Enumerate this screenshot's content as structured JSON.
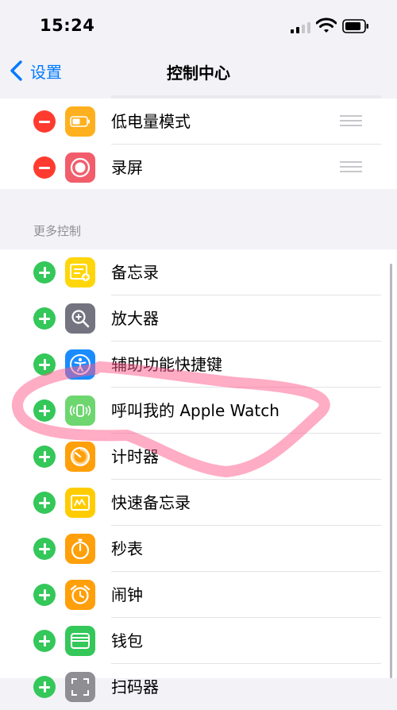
{
  "status_bar": {
    "time": "15:24"
  },
  "nav": {
    "back_label": "设置",
    "title": "控制中心"
  },
  "included": {
    "items": [
      {
        "label": "低电量模式",
        "icon": "battery-icon",
        "color": "#ffb01f"
      },
      {
        "label": "录屏",
        "icon": "record-icon",
        "color": "#f25d6b"
      }
    ]
  },
  "more": {
    "header": "更多控制",
    "items": [
      {
        "label": "备忘录",
        "icon": "notes-icon",
        "color": "#ffd60a"
      },
      {
        "label": "放大器",
        "icon": "magnifier-icon",
        "color": "#737480"
      },
      {
        "label": "辅助功能快捷键",
        "icon": "accessibility-icon",
        "color": "#1a8cff"
      },
      {
        "label": "呼叫我的 Apple Watch",
        "icon": "watch-ping-icon",
        "color": "#6ed66f"
      },
      {
        "label": "计时器",
        "icon": "timer-icon",
        "color": "#ff9f0a"
      },
      {
        "label": "快速备忘录",
        "icon": "quick-note-icon",
        "color": "#ffcc00"
      },
      {
        "label": "秒表",
        "icon": "stopwatch-icon",
        "color": "#ff9f0a"
      },
      {
        "label": "闹钟",
        "icon": "alarm-icon",
        "color": "#ff9f0a"
      },
      {
        "label": "钱包",
        "icon": "wallet-icon",
        "color": "#34c759"
      },
      {
        "label": "扫码器",
        "icon": "scanner-icon",
        "color": "#8e8e93"
      }
    ]
  },
  "colors": {
    "accent": "#007aff",
    "remove": "#ff3b30",
    "add": "#34c759",
    "annotation": "#ff5a8c"
  }
}
